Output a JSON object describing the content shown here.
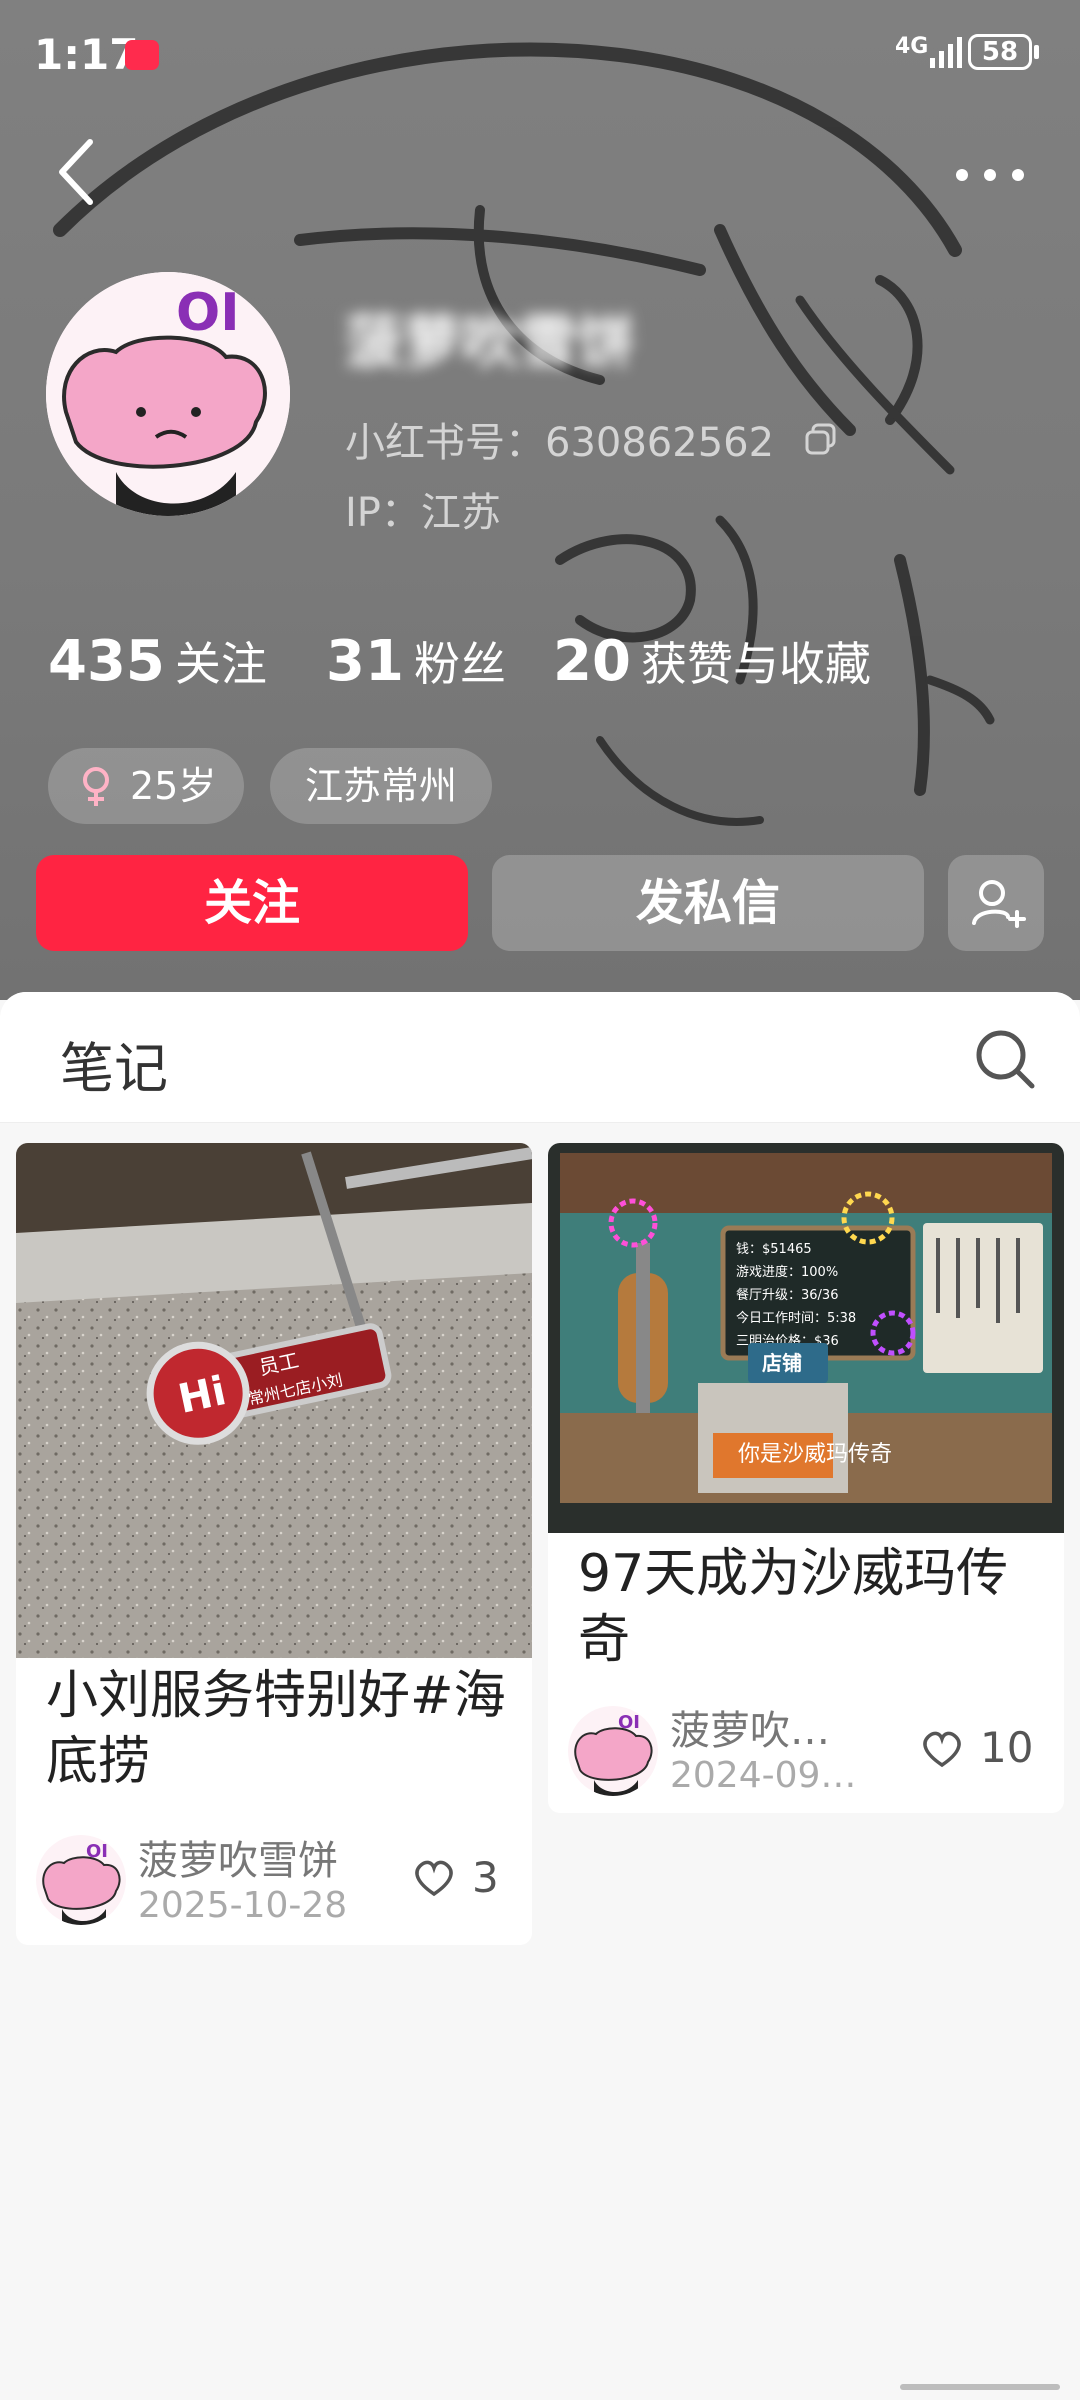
{
  "status_bar": {
    "time": "1:17",
    "network": "4G",
    "battery": "58"
  },
  "profile": {
    "username": "菠萝吹雪饼",
    "id_label": "小红书号：630862562",
    "ip_label": "IP：江苏",
    "stats": [
      {
        "num": "435",
        "label": "关注"
      },
      {
        "num": "31",
        "label": "粉丝"
      },
      {
        "num": "20",
        "label": "获赞与收藏"
      }
    ],
    "tags": {
      "age": "25岁",
      "location": "江苏常州"
    },
    "buttons": {
      "follow": "关注",
      "message": "发私信"
    }
  },
  "tabs": {
    "notes": "笔记"
  },
  "notes": [
    {
      "title": "小刘服务特别好#海底捞",
      "author": "菠萝吹雪饼",
      "date": "2025-10-28",
      "likes": "3",
      "image_texts": {
        "badge_top": "员工",
        "badge_bottom": "常州七店小刘"
      }
    },
    {
      "title": "97天成为沙威玛传奇",
      "author": "菠萝吹…",
      "date": "2024-09…",
      "likes": "10",
      "image_texts": {
        "board_lines": [
          "钱：$51465",
          "游戏进度：100%",
          "餐厅升级：36/36",
          "今日工作时间：5:38",
          "三明治价格：$36"
        ],
        "shop_sign": "店铺",
        "subtitle": "你是沙威玛传奇"
      }
    }
  ],
  "colors": {
    "accent": "#ff2442",
    "header_bg": "#7d7d7d"
  },
  "icons": [
    "back-arrow-icon",
    "more-dots-icon",
    "copy-icon",
    "female-icon",
    "add-user-icon",
    "search-icon",
    "heart-icon"
  ]
}
